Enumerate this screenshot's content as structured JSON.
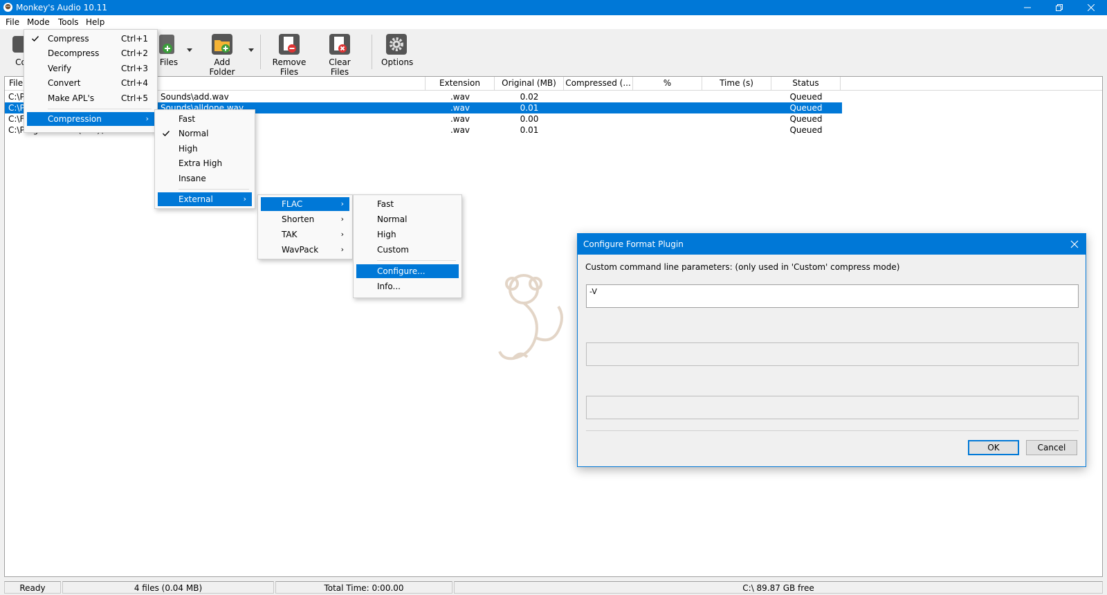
{
  "window": {
    "title": "Monkey's Audio 10.11"
  },
  "menubar": {
    "items": [
      "File",
      "Mode",
      "Tools",
      "Help"
    ]
  },
  "toolbar": {
    "buttons": [
      {
        "label": "Co",
        "icon": "compress-icon"
      },
      {
        "label": "Files",
        "icon": "add-files-icon"
      },
      {
        "label": "Add Folder",
        "icon": "add-folder-icon"
      },
      {
        "label": "Remove Files",
        "icon": "remove-files-icon"
      },
      {
        "label": "Clear Files",
        "icon": "clear-files-icon"
      },
      {
        "label": "Options",
        "icon": "gear-icon"
      }
    ]
  },
  "list": {
    "columns": [
      "File",
      "Extension",
      "Original (MB)",
      "Compressed (...",
      "%",
      "Time (s)",
      "Status"
    ],
    "rows": [
      {
        "file_left": "C:\\P",
        "file_right": "Sounds\\add.wav",
        "ext": ".wav",
        "orig": "0.02",
        "status": "Queued",
        "selected": false
      },
      {
        "file_left": "C:\\P",
        "file_right": "Sounds\\alldone.wav",
        "ext": ".wav",
        "orig": "0.01",
        "status": "Queued",
        "selected": true
      },
      {
        "file_left": "C:\\F",
        "file_right": "",
        "ext": ".wav",
        "orig": "0.00",
        "status": "Queued",
        "selected": false
      },
      {
        "file_left": "C:\\Program Files (x86)\\Download Master",
        "file_right": "",
        "ext": ".wav",
        "orig": "0.01",
        "status": "Queued",
        "selected": false
      }
    ]
  },
  "statusbar": {
    "ready": "Ready",
    "files": "4 files (0.04 MB)",
    "total_time": "Total Time: 0:00.00",
    "disk": "C:\\ 89.87 GB free"
  },
  "mode_menu": {
    "items": [
      {
        "label": "Compress",
        "shortcut": "Ctrl+1",
        "checked": true
      },
      {
        "label": "Decompress",
        "shortcut": "Ctrl+2",
        "checked": false
      },
      {
        "label": "Verify",
        "shortcut": "Ctrl+3",
        "checked": false
      },
      {
        "label": "Convert",
        "shortcut": "Ctrl+4",
        "checked": false
      },
      {
        "label": "Make APL's",
        "shortcut": "Ctrl+5",
        "checked": false
      }
    ],
    "compression": "Compression"
  },
  "compression_menu": {
    "items": [
      {
        "label": "Fast",
        "checked": false
      },
      {
        "label": "Normal",
        "checked": true
      },
      {
        "label": "High",
        "checked": false
      },
      {
        "label": "Extra High",
        "checked": false
      },
      {
        "label": "Insane",
        "checked": false
      }
    ],
    "external": "External"
  },
  "external_menu": {
    "items": [
      "FLAC",
      "Shorten",
      "TAK",
      "WavPack"
    ]
  },
  "flac_menu": {
    "items": [
      "Fast",
      "Normal",
      "High",
      "Custom"
    ],
    "configure": "Configure...",
    "info": "Info..."
  },
  "dialog": {
    "title": "Configure Format Plugin",
    "label": "Custom command line parameters: (only used in 'Custom' compress mode)",
    "param_value": "-V",
    "ok": "OK",
    "cancel": "Cancel"
  },
  "colors": {
    "accent": "#0078d7",
    "menu_bg": "#f9f9f9",
    "window_bg": "#f0f0f0"
  }
}
